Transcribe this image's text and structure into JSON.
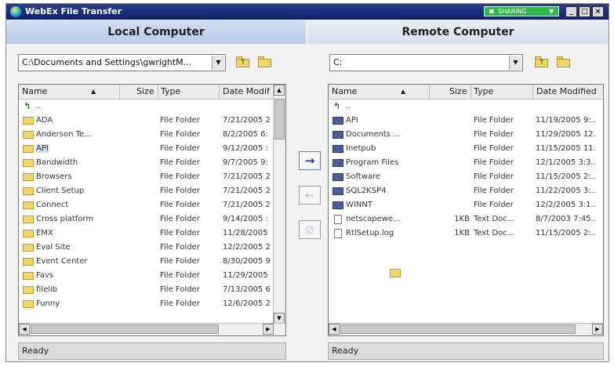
{
  "window": {
    "title": "WebEx File Transfer",
    "sharing_label": "SHARING"
  },
  "local": {
    "header": "Local Computer",
    "path": "C:\\Documents and Settings\\gwrightM...",
    "columns": {
      "name": "Name",
      "size": "Size",
      "type": "Type",
      "date": "Date Modif"
    },
    "up_label": "..",
    "files": [
      {
        "name": "ADA",
        "type": "File Folder",
        "date": "7/21/2005 2"
      },
      {
        "name": "Anderson Te...",
        "type": "File Folder",
        "date": "8/2/2005 6:"
      },
      {
        "name": "API",
        "type": "File Folder",
        "date": "9/12/2005 :"
      },
      {
        "name": "Bandwidth",
        "type": "File Folder",
        "date": "9/7/2005 9:"
      },
      {
        "name": "Browsers",
        "type": "File Folder",
        "date": "7/21/2005 2"
      },
      {
        "name": "Client Setup",
        "type": "File Folder",
        "date": "7/21/2005 2"
      },
      {
        "name": "Connect",
        "type": "File Folder",
        "date": "7/21/2005 2"
      },
      {
        "name": "Cross platform",
        "type": "File Folder",
        "date": "9/14/2005 :"
      },
      {
        "name": "EMX",
        "type": "File Folder",
        "date": "11/28/2005"
      },
      {
        "name": "Eval Site",
        "type": "File Folder",
        "date": "12/2/2005 2"
      },
      {
        "name": "Event Center",
        "type": "File Folder",
        "date": "8/30/2005 9"
      },
      {
        "name": "Favs",
        "type": "File Folder",
        "date": "11/29/2005"
      },
      {
        "name": "filelib",
        "type": "File Folder",
        "date": "7/13/2005 6"
      },
      {
        "name": "Funny",
        "type": "File Folder",
        "date": "12/6/2005 2"
      }
    ],
    "status": "Ready"
  },
  "remote": {
    "header": "Remote Computer",
    "path": "C:",
    "columns": {
      "name": "Name",
      "size": "Size",
      "type": "Type",
      "date": "Date Modified"
    },
    "up_label": "..",
    "files": [
      {
        "name": "API",
        "size": "",
        "type": "File Folder",
        "date": "11/19/2005 9:..",
        "icon": "dark"
      },
      {
        "name": "Documents ...",
        "size": "",
        "type": "File Folder",
        "date": "11/29/2005 12.",
        "icon": "dark"
      },
      {
        "name": "Inetpub",
        "size": "",
        "type": "File Folder",
        "date": "11/15/2005 11.",
        "icon": "dark"
      },
      {
        "name": "Program Files",
        "size": "",
        "type": "File Folder",
        "date": "12/1/2005 3:3..",
        "icon": "dark"
      },
      {
        "name": "Software",
        "size": "",
        "type": "File Folder",
        "date": "11/15/2005 2:..",
        "icon": "dark"
      },
      {
        "name": "SQL2KSP4",
        "size": "",
        "type": "File Folder",
        "date": "11/22/2005 3:..",
        "icon": "dark"
      },
      {
        "name": "WINNT",
        "size": "",
        "type": "File Folder",
        "date": "12/2/2005 3:1..",
        "icon": "dark"
      },
      {
        "name": "netscapewe...",
        "size": "1KB",
        "type": "Text Doc...",
        "date": "8/7/2003 7:45..",
        "icon": "doc"
      },
      {
        "name": "RtlSetup.log",
        "size": "1KB",
        "type": "Text Doc...",
        "date": "11/15/2005 2:..",
        "icon": "doc"
      }
    ],
    "status": "Ready"
  },
  "transfer": {
    "upload_glyph": "→",
    "download_glyph": "←",
    "cancel_glyph": "⊘"
  }
}
